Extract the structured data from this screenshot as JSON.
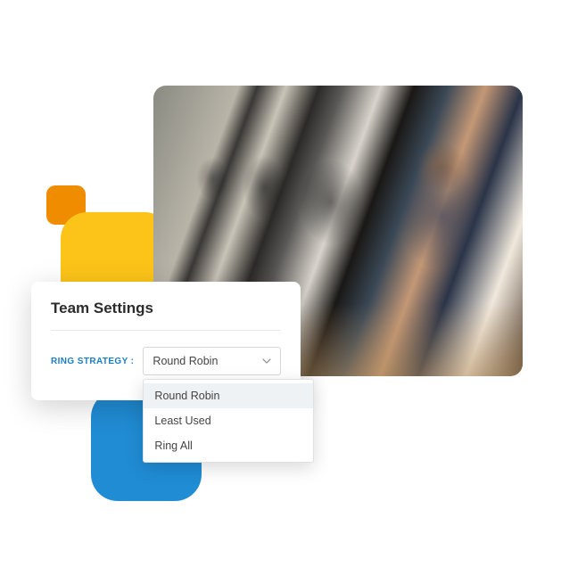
{
  "card": {
    "title": "Team Settings",
    "field_label": "RING STRATEGY :",
    "selected_value": "Round Robin",
    "options": [
      "Round Robin",
      "Least Used",
      "Ring All"
    ],
    "active_index": 0
  },
  "colors": {
    "orange": "#f08c00",
    "yellow": "#fcc419",
    "blue": "#208cd4",
    "accent": "#1b7fc4"
  }
}
